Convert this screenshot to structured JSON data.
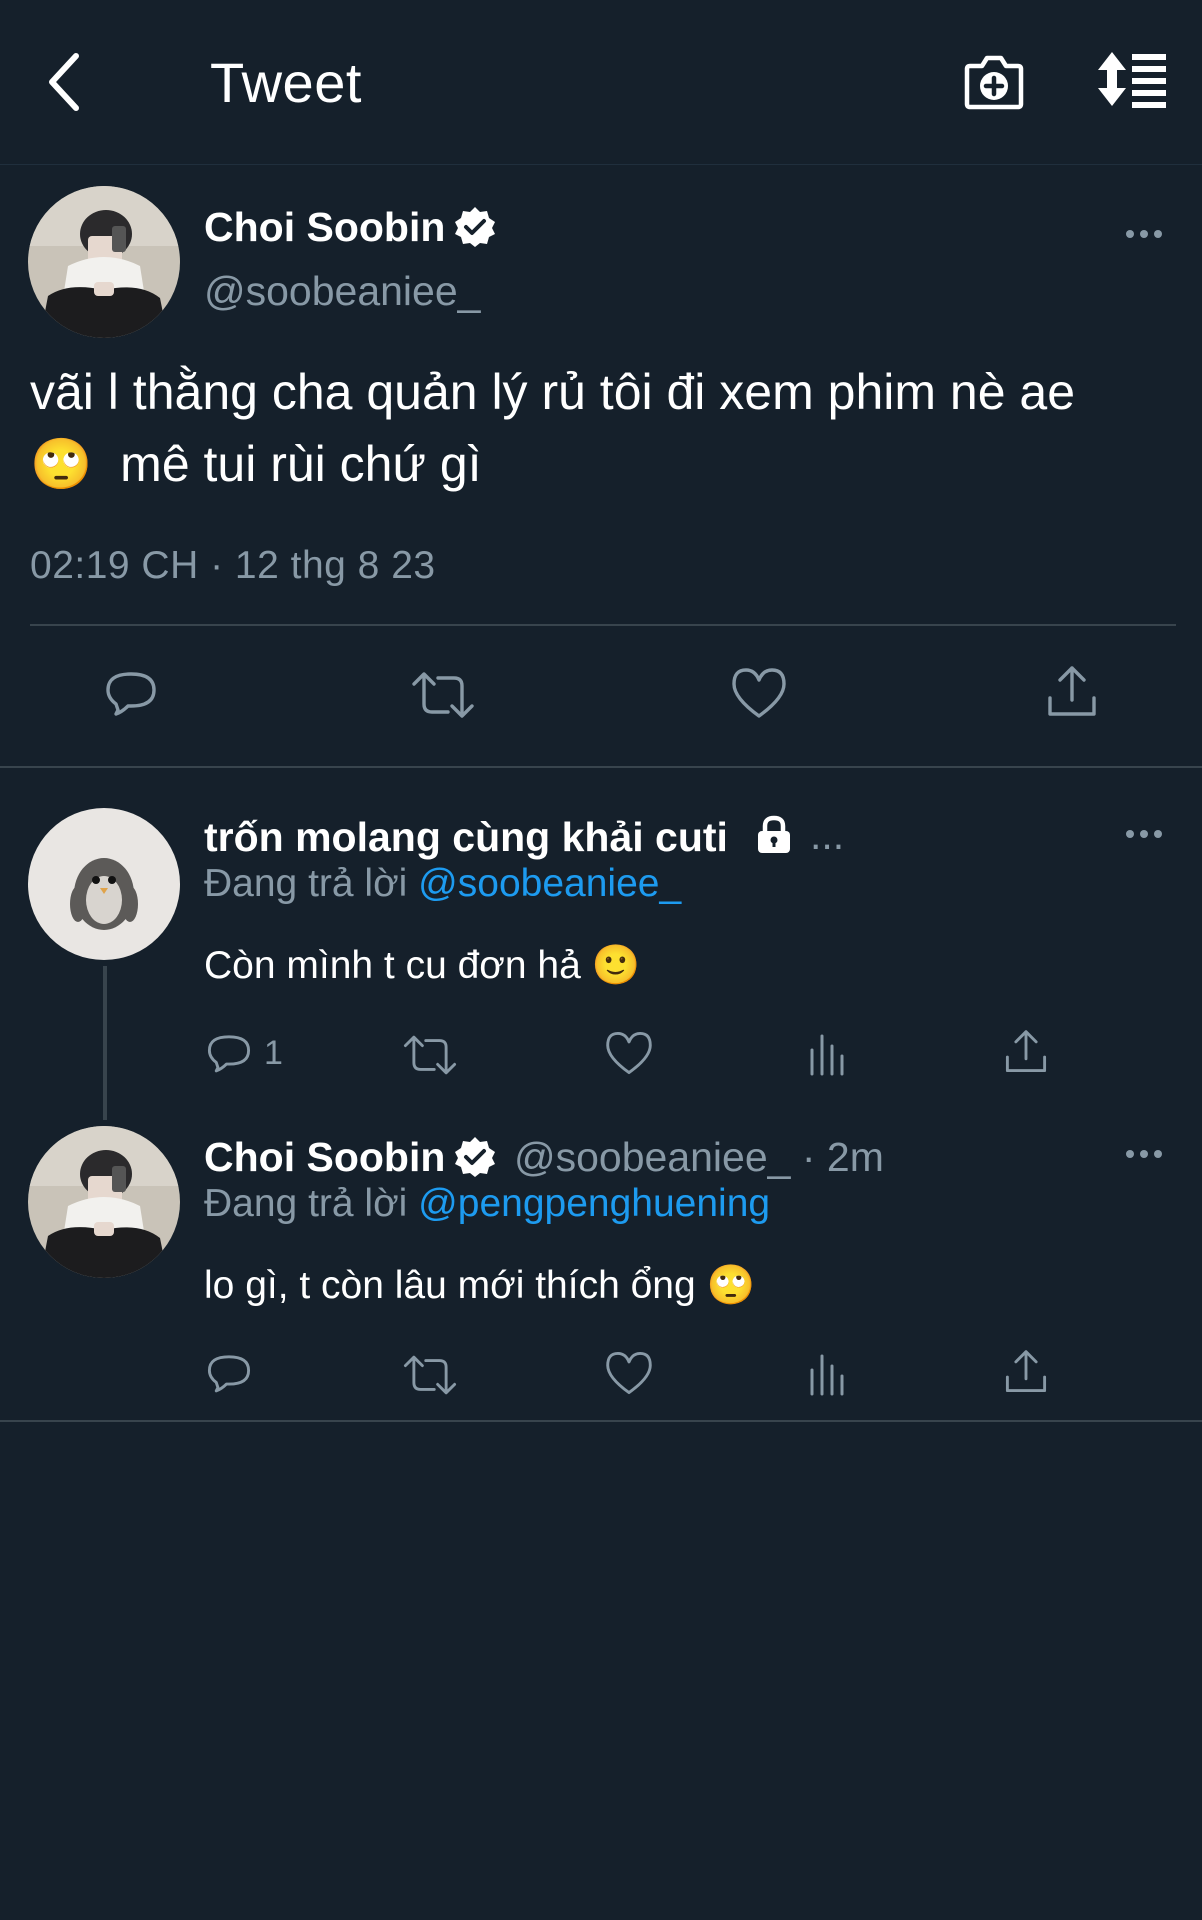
{
  "header": {
    "title": "Tweet",
    "icons": [
      "back-chevron-icon",
      "camera-add-icon",
      "sort-timeline-icon"
    ]
  },
  "main_tweet": {
    "name": "Choi Soobin",
    "handle": "@soobeaniee_",
    "text_line1": "vãi l thằng cha quản lý rủ tôi đi xem phim nè ae",
    "text_line2_emoji": "🙄",
    "text_line2": "mê tui rùi chứ gì",
    "timestamp": "02:19 CH · 12 thg 8 23"
  },
  "replies": [
    {
      "name": "trốn molang cùng khải cuti",
      "locked": true,
      "meta": "...",
      "replying_prefix": "Đang trả lời",
      "replying_to": "@soobeaniee_",
      "text": "Còn mình t cu đơn hả 🙂",
      "reply_count": "1"
    },
    {
      "name": "Choi Soobin",
      "handle": "@soobeaniee_",
      "time": "· 2m",
      "replying_prefix": "Đang trả lời",
      "replying_to": "@pengpenghuening",
      "text": "lo gì, t còn lâu mới thích ổng 🙄"
    }
  ],
  "colors": {
    "background": "#15202b",
    "muted": "#8899a6",
    "link": "#1d9bf0",
    "divider": "#38444d"
  }
}
